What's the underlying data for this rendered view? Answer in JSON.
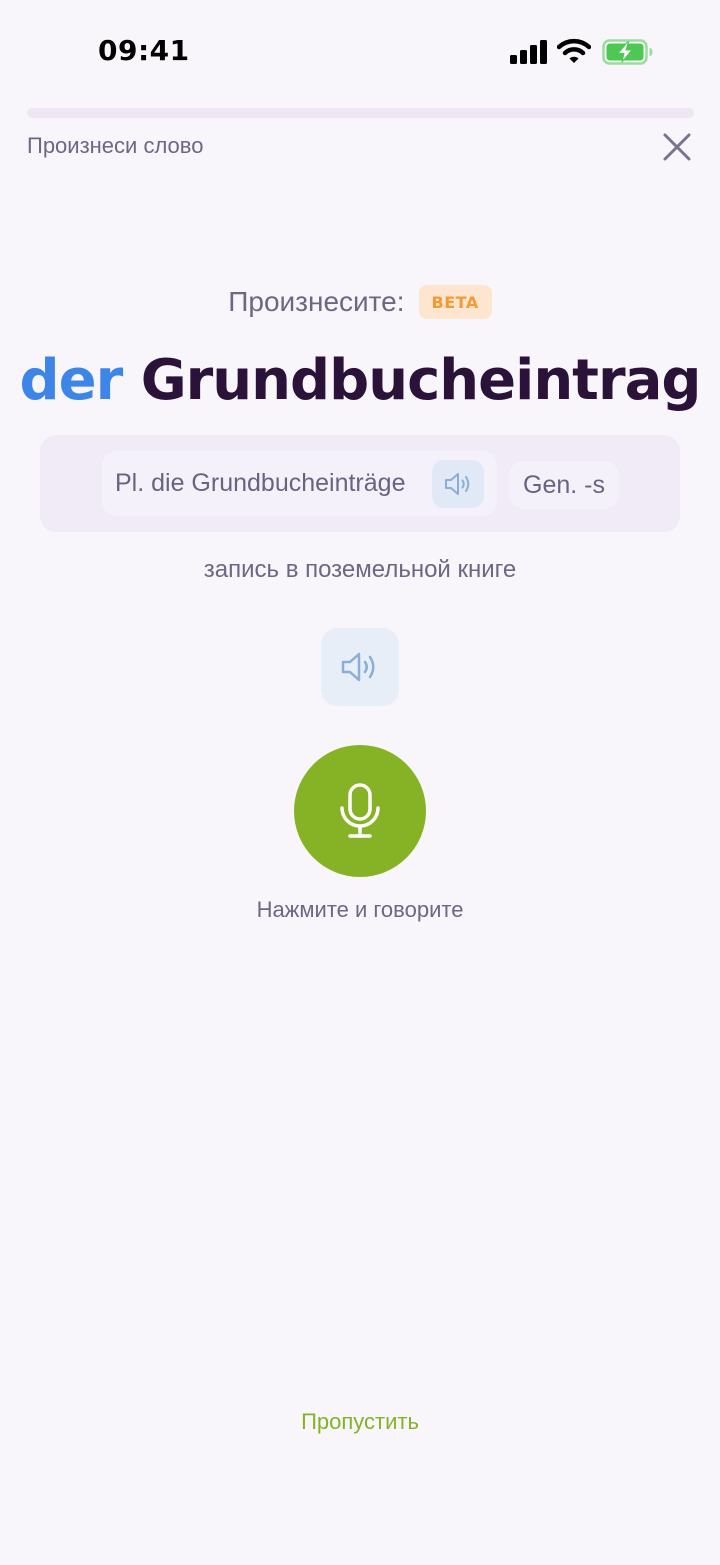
{
  "status_bar": {
    "time": "09:41",
    "signal_icon": "cellular-signal-icon",
    "wifi_icon": "wifi-icon",
    "battery_icon": "battery-charging-icon",
    "battery_color": "#4cc853"
  },
  "header": {
    "progress": 0,
    "title": "Произнеси слово",
    "close_icon": "close-icon"
  },
  "prompt": {
    "label": "Произнесите:",
    "badge": "BETA",
    "badge_color": "#f39a34"
  },
  "word": {
    "article": "der",
    "noun": "Grundbucheintrag",
    "article_color": "#3d86e8"
  },
  "forms": {
    "plural": "Pl. die Grundbucheinträge",
    "plural_audio_icon": "speaker-icon",
    "genitive": "Gen. -s"
  },
  "translation": "запись в поземельной книге",
  "audio_button_icon": "speaker-icon",
  "record": {
    "icon": "microphone-icon",
    "hint": "Нажмите и говорите",
    "accent_color": "#86b325"
  },
  "footer": {
    "skip_label": "Пропустить"
  }
}
